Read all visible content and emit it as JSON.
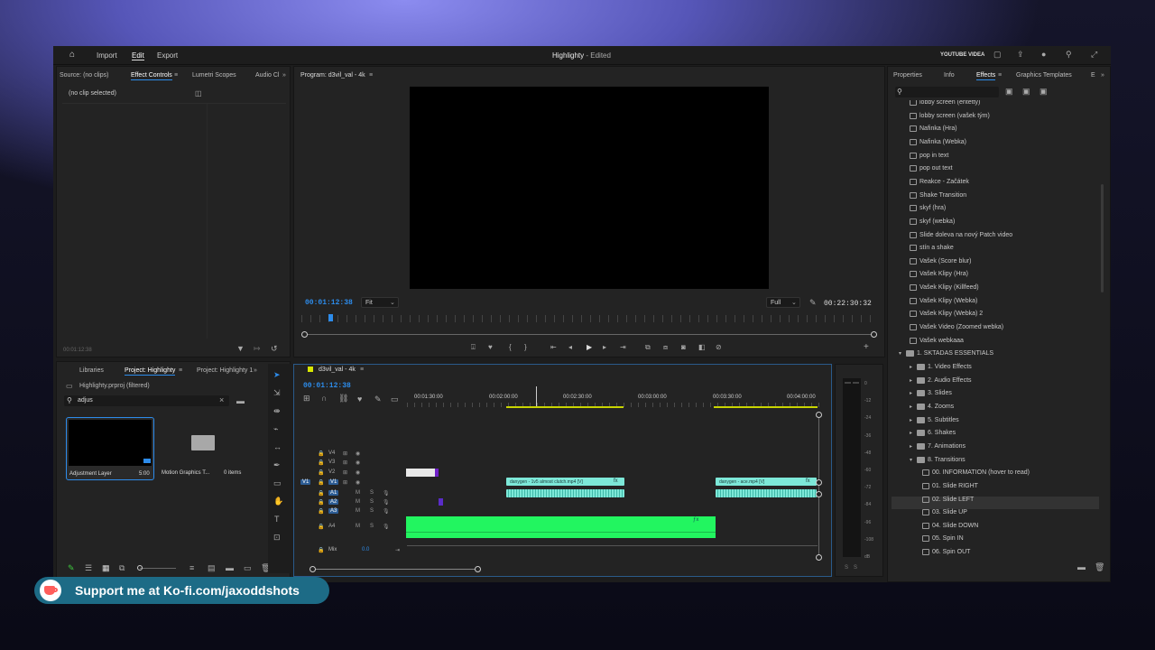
{
  "topbar": {
    "nav": [
      "Import",
      "Edit",
      "Export"
    ],
    "title": "Highlighty",
    "title_suffix": " - Edited",
    "workspace": "YOUTUBE VIDEA"
  },
  "source_panel": {
    "tabs": [
      "Source: (no clips)",
      "Effect Controls",
      "Lumetri Scopes",
      "Audio Cl"
    ],
    "no_clip": "(no clip selected)",
    "timecode": "00:01:12:38"
  },
  "program": {
    "title": "Program: d3vil_val - 4k",
    "timecode": "00:01:12:38",
    "zoom": "Fit",
    "quality": "Full",
    "duration": "00:22:30:32"
  },
  "project_panel": {
    "tabs": [
      "Libraries",
      "Project: Highlighty",
      "Project: Highlighty 1"
    ],
    "path": "Highlighty.prproj (filtered)",
    "search": "adjus",
    "items": [
      {
        "name": "Adjustment Layer",
        "meta": "5:00"
      },
      {
        "name": "Motion Graphics T...",
        "meta": "0 items"
      }
    ]
  },
  "timeline": {
    "sequence": "d3vil_val - 4k",
    "timecode": "00:01:12:38",
    "ruler": [
      "00:01:30:00",
      "00:02:00:00",
      "00:02:30:00",
      "00:03:00:00",
      "00:03:30:00",
      "00:04:00:00"
    ],
    "video_tracks": [
      "V4",
      "V3",
      "V2",
      "V1"
    ],
    "audio_tracks": [
      "A1",
      "A2",
      "A3",
      "A4"
    ],
    "mix_label": "Mix",
    "mix_value": "0.0",
    "clips": [
      {
        "label": "danygen - 1v5 almost clutch.mp4 [V]",
        "fx": "fx"
      },
      {
        "label": "danygen - ace.mp4 [V]",
        "fx": "fx"
      }
    ]
  },
  "meter": {
    "scale": [
      "0",
      "-12",
      "-24",
      "-36",
      "-48",
      "-60",
      "-72",
      "-84",
      "-96",
      "-108",
      "dB"
    ],
    "solo": [
      "S",
      "S"
    ]
  },
  "effects": {
    "tabs": [
      "Properties",
      "Info",
      "Effects",
      "Graphics Templates",
      "E"
    ],
    "items": [
      {
        "t": "file",
        "label": "lobby screen (entetty)"
      },
      {
        "t": "file",
        "label": "lobby screen (vašek tým)"
      },
      {
        "t": "file",
        "label": "Nafinka (Hra)"
      },
      {
        "t": "file",
        "label": "Nafinka (Webka)"
      },
      {
        "t": "file",
        "label": "pop in text"
      },
      {
        "t": "file",
        "label": "pop out text"
      },
      {
        "t": "file",
        "label": "Reakce - Začátek"
      },
      {
        "t": "file",
        "label": "Shake Transition"
      },
      {
        "t": "file",
        "label": "skyf (hra)"
      },
      {
        "t": "file",
        "label": "skyf (webka)"
      },
      {
        "t": "file",
        "label": "Slide doleva na nový Patch video"
      },
      {
        "t": "file",
        "label": "stín a shake"
      },
      {
        "t": "file",
        "label": "Vašek (Score blur)"
      },
      {
        "t": "file",
        "label": "Vašek Klipy (Hra)"
      },
      {
        "t": "file",
        "label": "Vašek Klipy (Killfeed)"
      },
      {
        "t": "file",
        "label": "Vašek Klipy (Webka)"
      },
      {
        "t": "file",
        "label": "Vašek Klipy (Webka) 2"
      },
      {
        "t": "file",
        "label": "Vašek Video (Zoomed webka)"
      },
      {
        "t": "file",
        "label": "Vašek webkaaa"
      },
      {
        "t": "open",
        "label": "1. SKTADAS ESSENTIALS"
      },
      {
        "t": "folder",
        "label": "1. Video Effects"
      },
      {
        "t": "folder",
        "label": "2. Audio Effects"
      },
      {
        "t": "folder",
        "label": "3. Slides"
      },
      {
        "t": "folder",
        "label": "4. Zooms"
      },
      {
        "t": "folder",
        "label": "5. Subtitles"
      },
      {
        "t": "folder",
        "label": "6. Shakes"
      },
      {
        "t": "folder",
        "label": "7. Animations"
      },
      {
        "t": "openfolder",
        "label": "8. Transitions"
      },
      {
        "t": "file2",
        "label": "00. INFORMATION (hover to read)"
      },
      {
        "t": "file2",
        "label": "01. Slide RIGHT"
      },
      {
        "t": "file2",
        "label": "02. Slide LEFT",
        "selected": true
      },
      {
        "t": "file2",
        "label": "03. Slide UP"
      },
      {
        "t": "file2",
        "label": "04. Slide DOWN"
      },
      {
        "t": "file2",
        "label": "05. Spin IN"
      },
      {
        "t": "file2",
        "label": "06. Spin OUT"
      }
    ]
  },
  "banner": {
    "text": "Support me at Ko-fi.com/jaxoddshots"
  },
  "colors": {
    "accent": "#2d8ceb",
    "clip_teal": "#7de8d8",
    "audio_green": "#22f560",
    "banner": "#1d6b86"
  }
}
